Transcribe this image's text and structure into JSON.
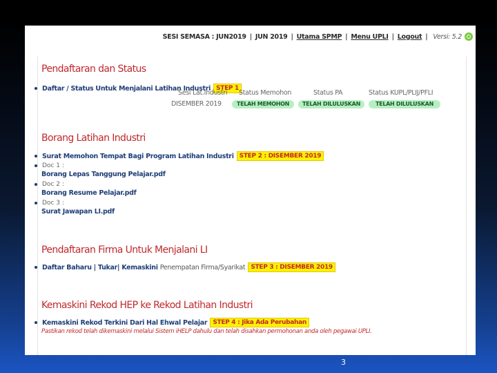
{
  "topbar": {
    "session_label": "SESI SEMASA : JUN2019",
    "session_value": "JUN 2019",
    "links": [
      "Utama SPMP",
      "Menu UPLI",
      "Logout"
    ],
    "version": "Versi: 5.2"
  },
  "section1": {
    "heading": "Pendaftaran dan Status",
    "item": "Daftar / Status Untuk Menjalani Latihan Industri",
    "step": "STEP 1",
    "table_headers": [
      "Sesi Lat.Industri",
      "Status Memohon",
      "Status PA",
      "Status KUPL/PLIJ/PFLI"
    ],
    "row_session": "DISEMBER 2019",
    "row_statuses": [
      "TELAH MEMOHON",
      "TELAH DILULUSKAN",
      "TELAH DILULUSKAN"
    ]
  },
  "section2": {
    "heading": "Borang Latihan Industri",
    "item": "Surat Memohon Tempat Bagi Program Latihan Industri",
    "step": "STEP 2 :   DISEMBER 2019",
    "docs": [
      {
        "label": "Doc 1 :",
        "file": "Borang Lepas Tanggung Pelajar.pdf"
      },
      {
        "label": "Doc 2 :",
        "file": "Borang Resume Pelajar.pdf"
      },
      {
        "label": "Doc 3 :",
        "file": "Surat Jawapan LI.pdf"
      }
    ]
  },
  "section3": {
    "heading": "Pendaftaran Firma Untuk Menjalani LI",
    "item_link": "Daftar Baharu | Tukar| Kemaskini",
    "item_plain": "Penempatan Firma/Syarikat",
    "step": "STEP 3 : DISEMBER 2019"
  },
  "section4": {
    "heading": "Kemaskini Rekod HEP ke Rekod Latihan Industri",
    "item": "Kemaskini Rekod Terkini Dari Hal Ehwal Pelajar",
    "step": "STEP 4 : Jika Ada Perubahan",
    "note": "Pastikan rekod telah dikemaskini melalui Sistem iHELP dahulu dan telah disahkan permohonan anda oleh pegawai UPLI."
  },
  "slide_number": "3"
}
